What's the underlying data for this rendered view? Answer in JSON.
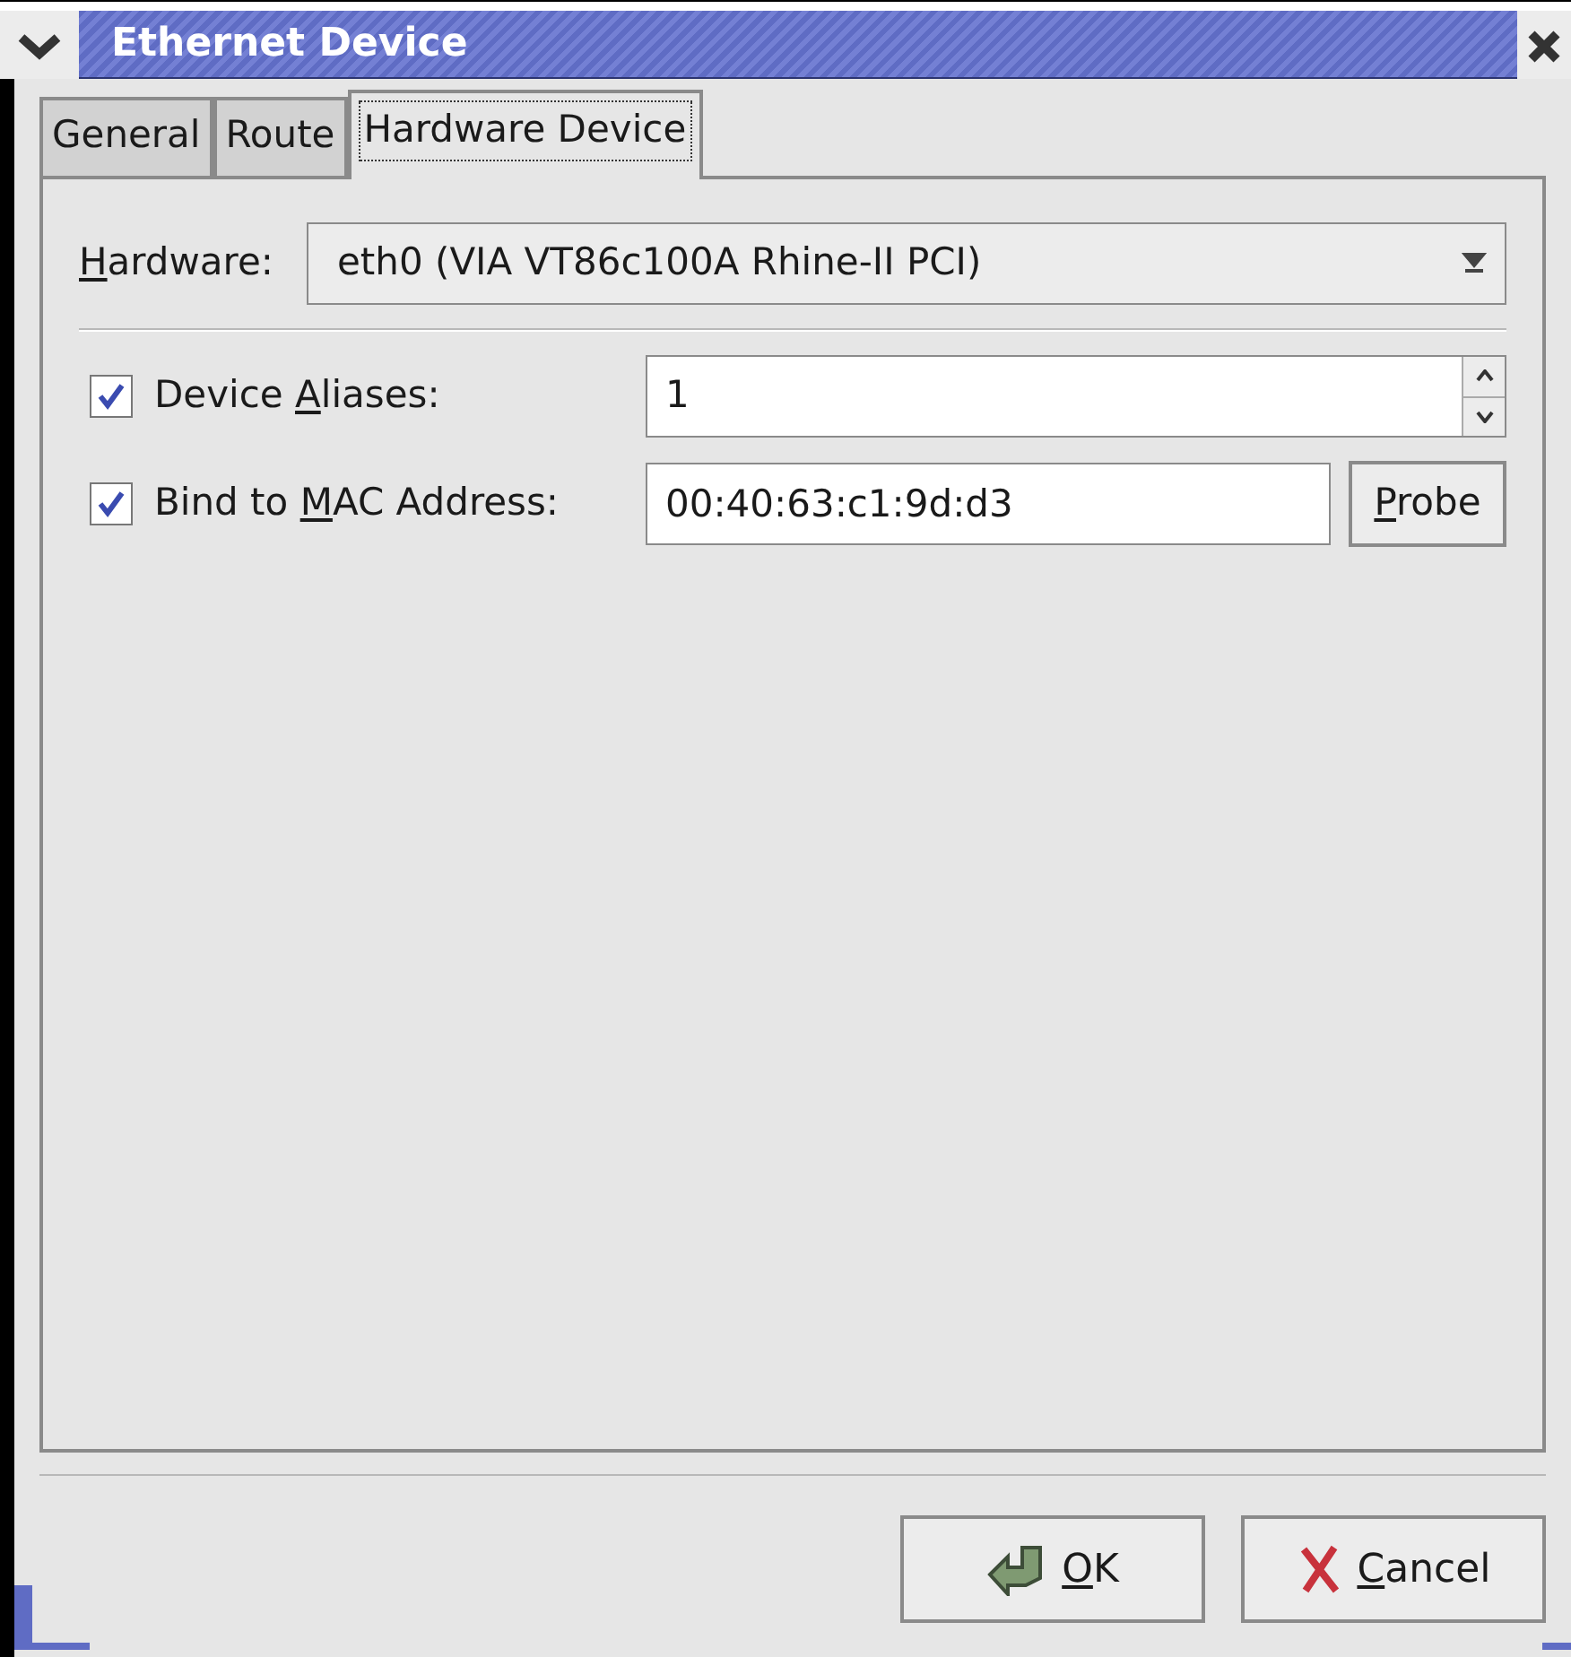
{
  "window": {
    "title": "Ethernet Device"
  },
  "tabs": [
    {
      "label": "General",
      "selected": false
    },
    {
      "label": "Route",
      "selected": false
    },
    {
      "label": "Hardware Device",
      "selected": true
    }
  ],
  "hardware": {
    "label": {
      "key": "H",
      "after": "ardware:"
    },
    "value": "eth0 (VIA VT86c100A Rhine-II PCI)"
  },
  "device_aliases": {
    "checked": true,
    "label": {
      "before": "Device ",
      "key": "A",
      "after": "liases:"
    },
    "value": "1"
  },
  "bind_mac": {
    "checked": true,
    "label": {
      "before": "Bind to ",
      "key": "M",
      "after": "AC Address:"
    },
    "value": "00:40:63:c1:9d:d3",
    "probe_button": {
      "key": "P",
      "after": "robe"
    }
  },
  "buttons": [
    {
      "kind": "ok",
      "label": {
        "key": "O",
        "after": "K"
      }
    },
    {
      "kind": "cancel",
      "label": {
        "key": "C",
        "after": "ancel"
      }
    }
  ]
}
